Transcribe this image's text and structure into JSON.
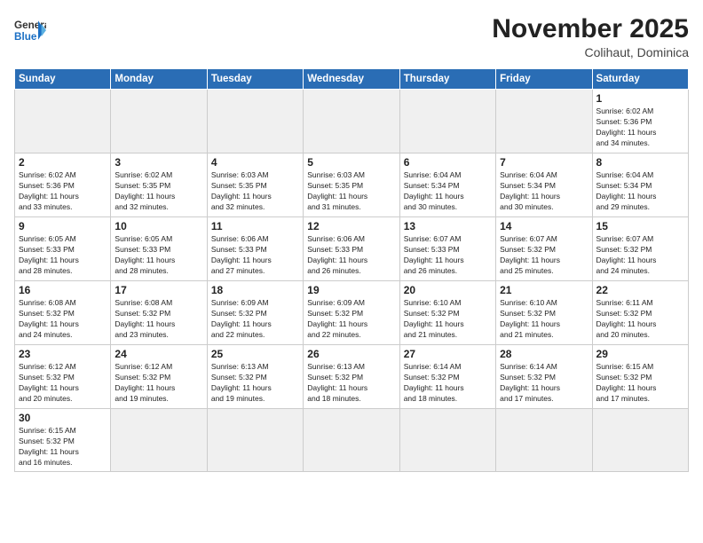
{
  "logo": {
    "line1": "General",
    "line2": "Blue"
  },
  "header": {
    "month": "November 2025",
    "location": "Colihaut, Dominica"
  },
  "weekdays": [
    "Sunday",
    "Monday",
    "Tuesday",
    "Wednesday",
    "Thursday",
    "Friday",
    "Saturday"
  ],
  "days": [
    {
      "date": "",
      "info": ""
    },
    {
      "date": "",
      "info": ""
    },
    {
      "date": "",
      "info": ""
    },
    {
      "date": "",
      "info": ""
    },
    {
      "date": "",
      "info": ""
    },
    {
      "date": "",
      "info": ""
    },
    {
      "date": "1",
      "info": "Sunrise: 6:02 AM\nSunset: 5:36 PM\nDaylight: 11 hours\nand 34 minutes."
    },
    {
      "date": "2",
      "info": "Sunrise: 6:02 AM\nSunset: 5:36 PM\nDaylight: 11 hours\nand 33 minutes."
    },
    {
      "date": "3",
      "info": "Sunrise: 6:02 AM\nSunset: 5:35 PM\nDaylight: 11 hours\nand 32 minutes."
    },
    {
      "date": "4",
      "info": "Sunrise: 6:03 AM\nSunset: 5:35 PM\nDaylight: 11 hours\nand 32 minutes."
    },
    {
      "date": "5",
      "info": "Sunrise: 6:03 AM\nSunset: 5:35 PM\nDaylight: 11 hours\nand 31 minutes."
    },
    {
      "date": "6",
      "info": "Sunrise: 6:04 AM\nSunset: 5:34 PM\nDaylight: 11 hours\nand 30 minutes."
    },
    {
      "date": "7",
      "info": "Sunrise: 6:04 AM\nSunset: 5:34 PM\nDaylight: 11 hours\nand 30 minutes."
    },
    {
      "date": "8",
      "info": "Sunrise: 6:04 AM\nSunset: 5:34 PM\nDaylight: 11 hours\nand 29 minutes."
    },
    {
      "date": "9",
      "info": "Sunrise: 6:05 AM\nSunset: 5:33 PM\nDaylight: 11 hours\nand 28 minutes."
    },
    {
      "date": "10",
      "info": "Sunrise: 6:05 AM\nSunset: 5:33 PM\nDaylight: 11 hours\nand 28 minutes."
    },
    {
      "date": "11",
      "info": "Sunrise: 6:06 AM\nSunset: 5:33 PM\nDaylight: 11 hours\nand 27 minutes."
    },
    {
      "date": "12",
      "info": "Sunrise: 6:06 AM\nSunset: 5:33 PM\nDaylight: 11 hours\nand 26 minutes."
    },
    {
      "date": "13",
      "info": "Sunrise: 6:07 AM\nSunset: 5:33 PM\nDaylight: 11 hours\nand 26 minutes."
    },
    {
      "date": "14",
      "info": "Sunrise: 6:07 AM\nSunset: 5:32 PM\nDaylight: 11 hours\nand 25 minutes."
    },
    {
      "date": "15",
      "info": "Sunrise: 6:07 AM\nSunset: 5:32 PM\nDaylight: 11 hours\nand 24 minutes."
    },
    {
      "date": "16",
      "info": "Sunrise: 6:08 AM\nSunset: 5:32 PM\nDaylight: 11 hours\nand 24 minutes."
    },
    {
      "date": "17",
      "info": "Sunrise: 6:08 AM\nSunset: 5:32 PM\nDaylight: 11 hours\nand 23 minutes."
    },
    {
      "date": "18",
      "info": "Sunrise: 6:09 AM\nSunset: 5:32 PM\nDaylight: 11 hours\nand 22 minutes."
    },
    {
      "date": "19",
      "info": "Sunrise: 6:09 AM\nSunset: 5:32 PM\nDaylight: 11 hours\nand 22 minutes."
    },
    {
      "date": "20",
      "info": "Sunrise: 6:10 AM\nSunset: 5:32 PM\nDaylight: 11 hours\nand 21 minutes."
    },
    {
      "date": "21",
      "info": "Sunrise: 6:10 AM\nSunset: 5:32 PM\nDaylight: 11 hours\nand 21 minutes."
    },
    {
      "date": "22",
      "info": "Sunrise: 6:11 AM\nSunset: 5:32 PM\nDaylight: 11 hours\nand 20 minutes."
    },
    {
      "date": "23",
      "info": "Sunrise: 6:12 AM\nSunset: 5:32 PM\nDaylight: 11 hours\nand 20 minutes."
    },
    {
      "date": "24",
      "info": "Sunrise: 6:12 AM\nSunset: 5:32 PM\nDaylight: 11 hours\nand 19 minutes."
    },
    {
      "date": "25",
      "info": "Sunrise: 6:13 AM\nSunset: 5:32 PM\nDaylight: 11 hours\nand 19 minutes."
    },
    {
      "date": "26",
      "info": "Sunrise: 6:13 AM\nSunset: 5:32 PM\nDaylight: 11 hours\nand 18 minutes."
    },
    {
      "date": "27",
      "info": "Sunrise: 6:14 AM\nSunset: 5:32 PM\nDaylight: 11 hours\nand 18 minutes."
    },
    {
      "date": "28",
      "info": "Sunrise: 6:14 AM\nSunset: 5:32 PM\nDaylight: 11 hours\nand 17 minutes."
    },
    {
      "date": "29",
      "info": "Sunrise: 6:15 AM\nSunset: 5:32 PM\nDaylight: 11 hours\nand 17 minutes."
    },
    {
      "date": "30",
      "info": "Sunrise: 6:15 AM\nSunset: 5:32 PM\nDaylight: 11 hours\nand 16 minutes."
    },
    {
      "date": "",
      "info": ""
    },
    {
      "date": "",
      "info": ""
    },
    {
      "date": "",
      "info": ""
    },
    {
      "date": "",
      "info": ""
    },
    {
      "date": "",
      "info": ""
    },
    {
      "date": "",
      "info": ""
    }
  ]
}
